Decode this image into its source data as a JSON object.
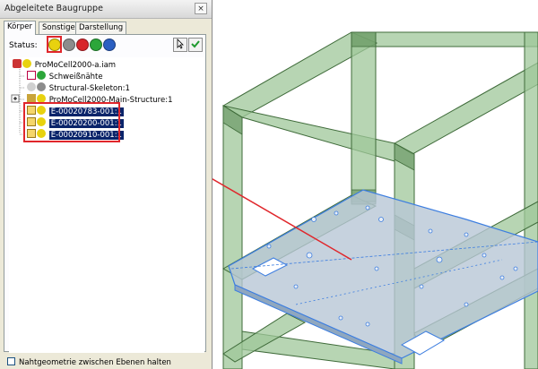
{
  "dialog": {
    "title": "Abgeleitete Baugruppe",
    "close_glyph": "×",
    "tabs": [
      {
        "label": "Körper",
        "active": true
      },
      {
        "label": "Sonstiges",
        "active": false
      },
      {
        "label": "Darstellung",
        "active": false
      }
    ],
    "status_label": "Status:",
    "status_buttons": [
      {
        "icon": "include-plus-icon",
        "color": "#e8d20f",
        "glyph": "+"
      },
      {
        "icon": "exclude-gray-icon",
        "color": "#8c8c8c",
        "glyph": ""
      },
      {
        "icon": "exclude-red-icon",
        "color": "#d8262b",
        "glyph": "–"
      },
      {
        "icon": "body-green-icon",
        "color": "#2ca63a",
        "glyph": "▪"
      },
      {
        "icon": "surface-blue-icon",
        "color": "#2a5fc1",
        "glyph": "▫"
      }
    ],
    "tree": [
      {
        "label": "ProMoCell2000-a.iam",
        "icon": "assembly-icon",
        "selected": false
      },
      {
        "label": "Schweißnähte",
        "icon": "weld-icon",
        "selected": false
      },
      {
        "label": "Structural-Skeleton:1",
        "icon": "skeleton-part-icon",
        "selected": false
      },
      {
        "label": "ProMoCell2000-Main-Structure:1",
        "icon": "subassembly-icon",
        "selected": false
      },
      {
        "label": "E-00020783-001:1",
        "icon": "part-icon",
        "selected": true
      },
      {
        "label": "E-00020200-001:1",
        "icon": "part-icon",
        "selected": true
      },
      {
        "label": "E-00020910-001:1",
        "icon": "part-icon",
        "selected": true
      }
    ],
    "checkbox_label": "Nahtgeometrie zwischen Ebenen halten"
  },
  "colors": {
    "frame_fill": "#9fc79a",
    "frame_stroke": "#3f6b3a",
    "plate_fill": "#b8c7d6",
    "plate_stroke": "#3d7ee0",
    "highlight": "#e0262b"
  }
}
